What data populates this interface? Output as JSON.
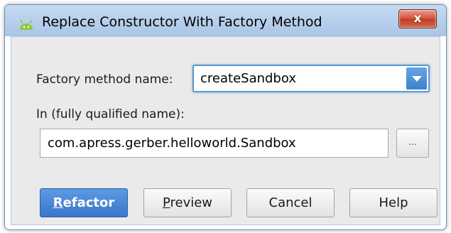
{
  "dialog": {
    "title": "Replace Constructor With Factory Method",
    "close_glyph": "x",
    "icon": "android-icon"
  },
  "factory": {
    "label": "Factory method name:",
    "value": "createSandbox"
  },
  "qualified": {
    "label": "In (fully qualified name):",
    "value": "com.apress.gerber.helloworld.Sandbox",
    "browse_label": "..."
  },
  "buttons": {
    "refactor": {
      "mnemonic": "R",
      "rest": "efactor"
    },
    "preview": {
      "mnemonic": "P",
      "rest": "review"
    },
    "cancel": "Cancel",
    "help": "Help"
  },
  "colors": {
    "accent": "#3b76c9",
    "focus_border": "#5b9bd6",
    "close_button": "#c13b22",
    "titlebar": "#b9d1ec"
  }
}
